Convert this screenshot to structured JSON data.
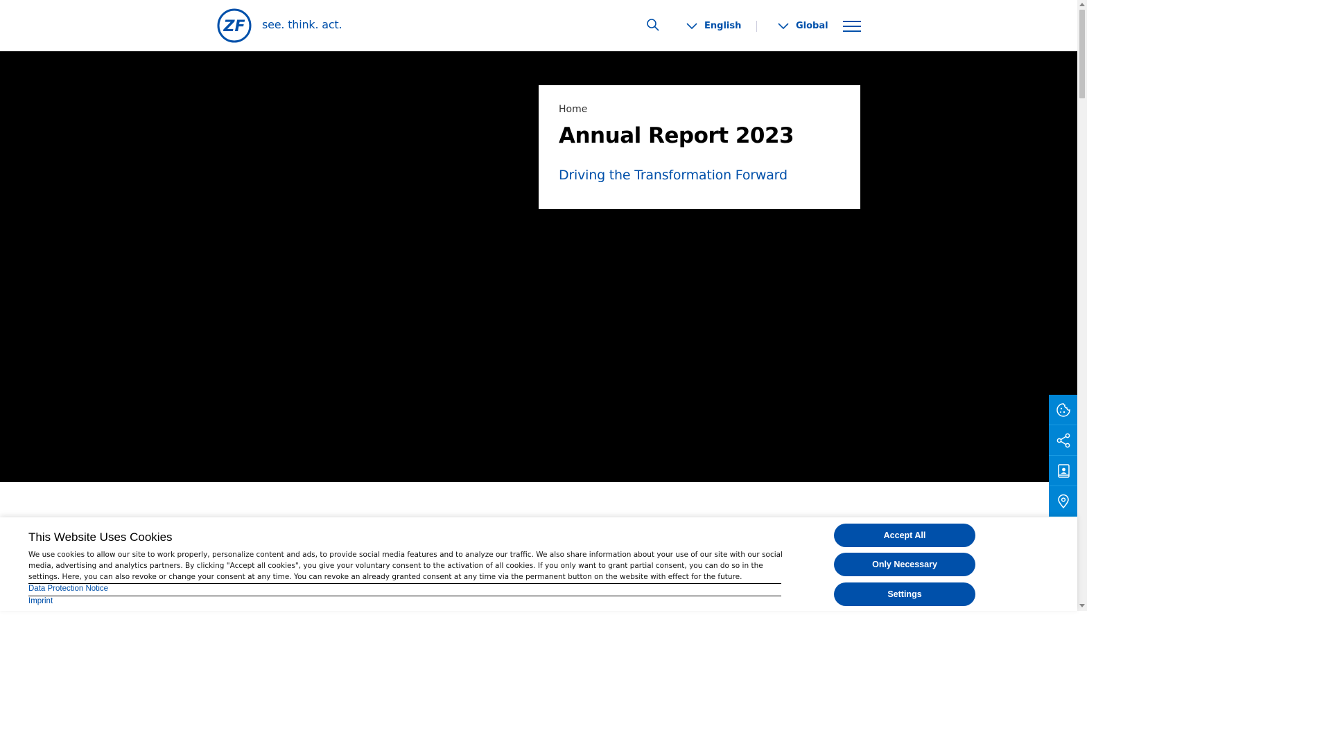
{
  "header": {
    "logo_alt": "ZF",
    "tagline": "see. think. act.",
    "language": "English",
    "region": "Global"
  },
  "hero": {
    "breadcrumb": "Home",
    "title": "Annual Report 2023",
    "subtitle": "Driving the Transformation Forward"
  },
  "side_actions": [
    {
      "icon": "cookie-icon"
    },
    {
      "icon": "share-icon"
    },
    {
      "icon": "contact-book-icon"
    },
    {
      "icon": "location-pin-icon"
    }
  ],
  "cookie_banner": {
    "title": "This Website Uses Cookies",
    "text": "We use cookies to allow our site to work properly, personalize content and ads, to provide social media features and to analyze our traffic. We also share information about your use of our site with our social media, advertising and analytics partners. By clicking \"Accept all cookies\", you give your voluntary consent to the activation of all cookies. If you only want to grant partial consent, you can do so in the settings. Here, you can also revoke or change your consent at any time. You can revoke an already granted consent at any time via the permanent button on the website with effect for the future.",
    "links": [
      "Data Protection Notice",
      "Imprint"
    ],
    "buttons": {
      "accept_all": "Accept All",
      "only_necessary": "Only Necessary",
      "settings": "Settings"
    }
  },
  "colors": {
    "brand_blue": "#0050aa",
    "side_button_blue": "#0085d5",
    "hero_background": "#000000"
  }
}
